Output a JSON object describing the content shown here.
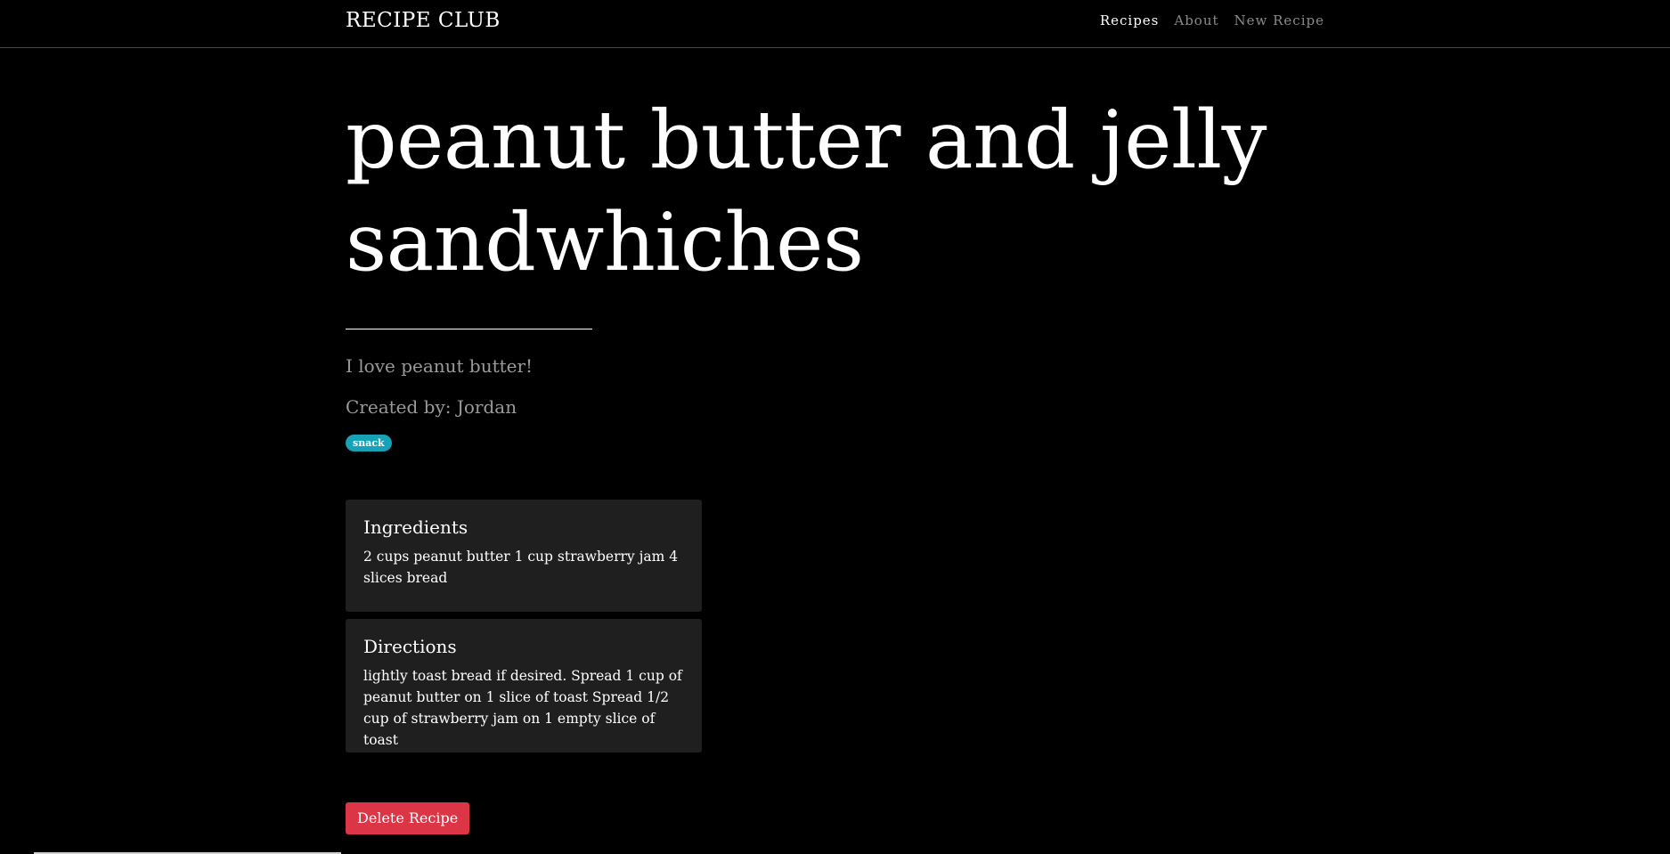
{
  "navbar": {
    "brand": "RECIPE CLUB",
    "links": [
      {
        "label": "Recipes",
        "active": true
      },
      {
        "label": "About",
        "active": false
      },
      {
        "label": "New Recipe",
        "active": false
      }
    ]
  },
  "recipe": {
    "title": "peanut butter and jelly sandwhiches",
    "description": "I love peanut butter!",
    "created_by": "Created by: Jordan",
    "tag": "snack",
    "ingredients": {
      "heading": "Ingredients",
      "text": "2 cups peanut butter 1 cup strawberry jam 4 slices bread"
    },
    "directions": {
      "heading": "Directions",
      "text": "lightly toast bread if desired. Spread 1 cup of peanut butter on 1 slice of toast Spread 1/2 cup of strawberry jam on 1 empty slice of toast"
    },
    "delete_label": "Delete Recipe"
  },
  "colors": {
    "background": "#000000",
    "card": "#1f1f1f",
    "tag": "#17a2b8",
    "danger": "#dc3545",
    "muted": "#9a9a9a"
  }
}
